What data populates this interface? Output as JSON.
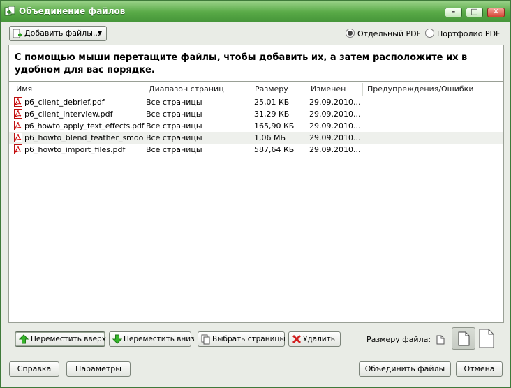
{
  "window": {
    "title": "Объединение файлов"
  },
  "toolbar": {
    "add_files": "Добавить файлы..."
  },
  "output": {
    "separate_pdf": "Отдельный PDF",
    "portfolio_pdf": "Портфолио PDF",
    "selected": "separate"
  },
  "instruction": "С помощью мыши перетащите файлы, чтобы добавить их, а затем расположите их в удобном для вас порядке.",
  "table": {
    "headers": [
      "Имя",
      "Диапазон страниц",
      "Размеру",
      "Изменен",
      "Предупреждения/Ошибки"
    ],
    "rows": [
      {
        "name": "p6_client_debrief.pdf",
        "range": "Все страницы",
        "size": "25,01 КБ",
        "modified": "29.09.2010...",
        "warnings": ""
      },
      {
        "name": "p6_client_interview.pdf",
        "range": "Все страницы",
        "size": "31,29 КБ",
        "modified": "29.09.2010...",
        "warnings": ""
      },
      {
        "name": "p6_howto_apply_text_effects.pdf",
        "range": "Все страницы",
        "size": "165,90 КБ",
        "modified": "29.09.2010...",
        "warnings": ""
      },
      {
        "name": "p6_howto_blend_feather_smoo...",
        "range": "Все страницы",
        "size": "1,06 МБ",
        "modified": "29.09.2010...",
        "warnings": ""
      },
      {
        "name": "p6_howto_import_files.pdf",
        "range": "Все страницы",
        "size": "587,64 КБ",
        "modified": "29.09.2010...",
        "warnings": ""
      }
    ]
  },
  "actions": {
    "move_up": "Переместить вверх",
    "move_down": "Переместить вниз",
    "choose_pages": "Выбрать страницы",
    "delete": "Удалить",
    "file_size_label": "Размеру файла:"
  },
  "footer": {
    "help": "Справка",
    "options": "Параметры",
    "combine": "Объединить файлы",
    "cancel": "Отмена"
  }
}
